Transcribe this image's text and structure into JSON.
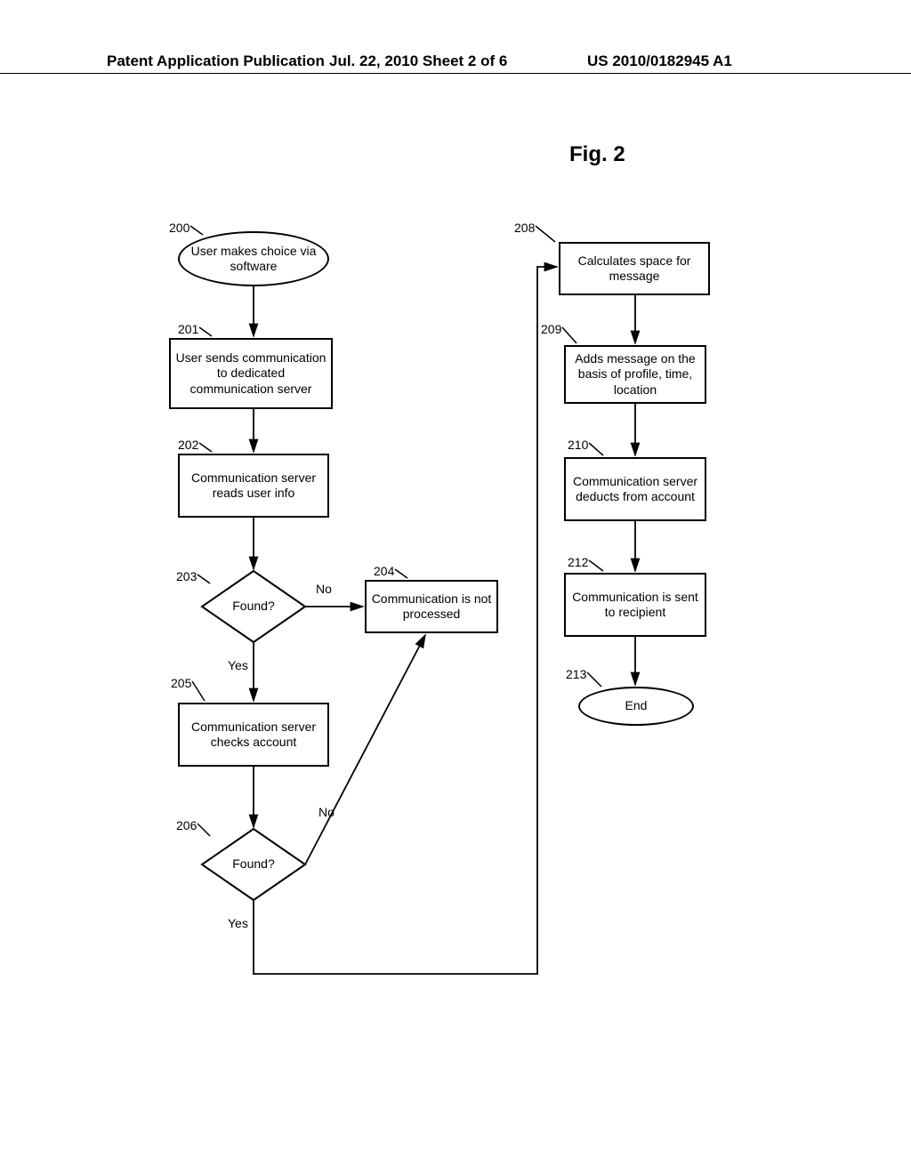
{
  "header": {
    "left": "Patent Application Publication",
    "center": "Jul. 22, 2010  Sheet 2 of 6",
    "right": "US 2010/0182945 A1"
  },
  "figure_label": "Fig. 2",
  "nodes": {
    "n200": {
      "ref": "200",
      "text": "User makes choice via software"
    },
    "n201": {
      "ref": "201",
      "text": "User sends communication to dedicated communication server"
    },
    "n202": {
      "ref": "202",
      "text": "Communication server reads user info"
    },
    "n203": {
      "ref": "203",
      "text": "Found?"
    },
    "n204": {
      "ref": "204",
      "text": "Communication is not processed"
    },
    "n205": {
      "ref": "205",
      "text": "Communication server checks account"
    },
    "n206": {
      "ref": "206",
      "text": "Found?"
    },
    "n208": {
      "ref": "208",
      "text": "Calculates space for message"
    },
    "n209": {
      "ref": "209",
      "text": "Adds message on the basis of profile, time, location"
    },
    "n210": {
      "ref": "210",
      "text": "Communication server deducts from account"
    },
    "n212": {
      "ref": "212",
      "text": "Communication is sent to recipient"
    },
    "n213": {
      "ref": "213",
      "text": "End"
    }
  },
  "edge_labels": {
    "no1": "No",
    "yes1": "Yes",
    "no2": "No",
    "yes2": "Yes"
  },
  "chart_data": {
    "type": "flowchart",
    "nodes": [
      {
        "id": "200",
        "shape": "terminator",
        "text": "User makes choice via software"
      },
      {
        "id": "201",
        "shape": "process",
        "text": "User sends communication to dedicated communication server"
      },
      {
        "id": "202",
        "shape": "process",
        "text": "Communication server reads user info"
      },
      {
        "id": "203",
        "shape": "decision",
        "text": "Found?"
      },
      {
        "id": "204",
        "shape": "process",
        "text": "Communication is not processed"
      },
      {
        "id": "205",
        "shape": "process",
        "text": "Communication server checks account"
      },
      {
        "id": "206",
        "shape": "decision",
        "text": "Found?"
      },
      {
        "id": "208",
        "shape": "process",
        "text": "Calculates space for message"
      },
      {
        "id": "209",
        "shape": "process",
        "text": "Adds message on the basis of profile, time, location"
      },
      {
        "id": "210",
        "shape": "process",
        "text": "Communication server deducts from account"
      },
      {
        "id": "212",
        "shape": "process",
        "text": "Communication is sent to recipient"
      },
      {
        "id": "213",
        "shape": "terminator",
        "text": "End"
      }
    ],
    "edges": [
      {
        "from": "200",
        "to": "201"
      },
      {
        "from": "201",
        "to": "202"
      },
      {
        "from": "202",
        "to": "203"
      },
      {
        "from": "203",
        "to": "204",
        "label": "No"
      },
      {
        "from": "203",
        "to": "205",
        "label": "Yes"
      },
      {
        "from": "205",
        "to": "206"
      },
      {
        "from": "206",
        "to": "204",
        "label": "No"
      },
      {
        "from": "206",
        "to": "208",
        "label": "Yes"
      },
      {
        "from": "208",
        "to": "209"
      },
      {
        "from": "209",
        "to": "210"
      },
      {
        "from": "210",
        "to": "212"
      },
      {
        "from": "212",
        "to": "213"
      }
    ]
  }
}
